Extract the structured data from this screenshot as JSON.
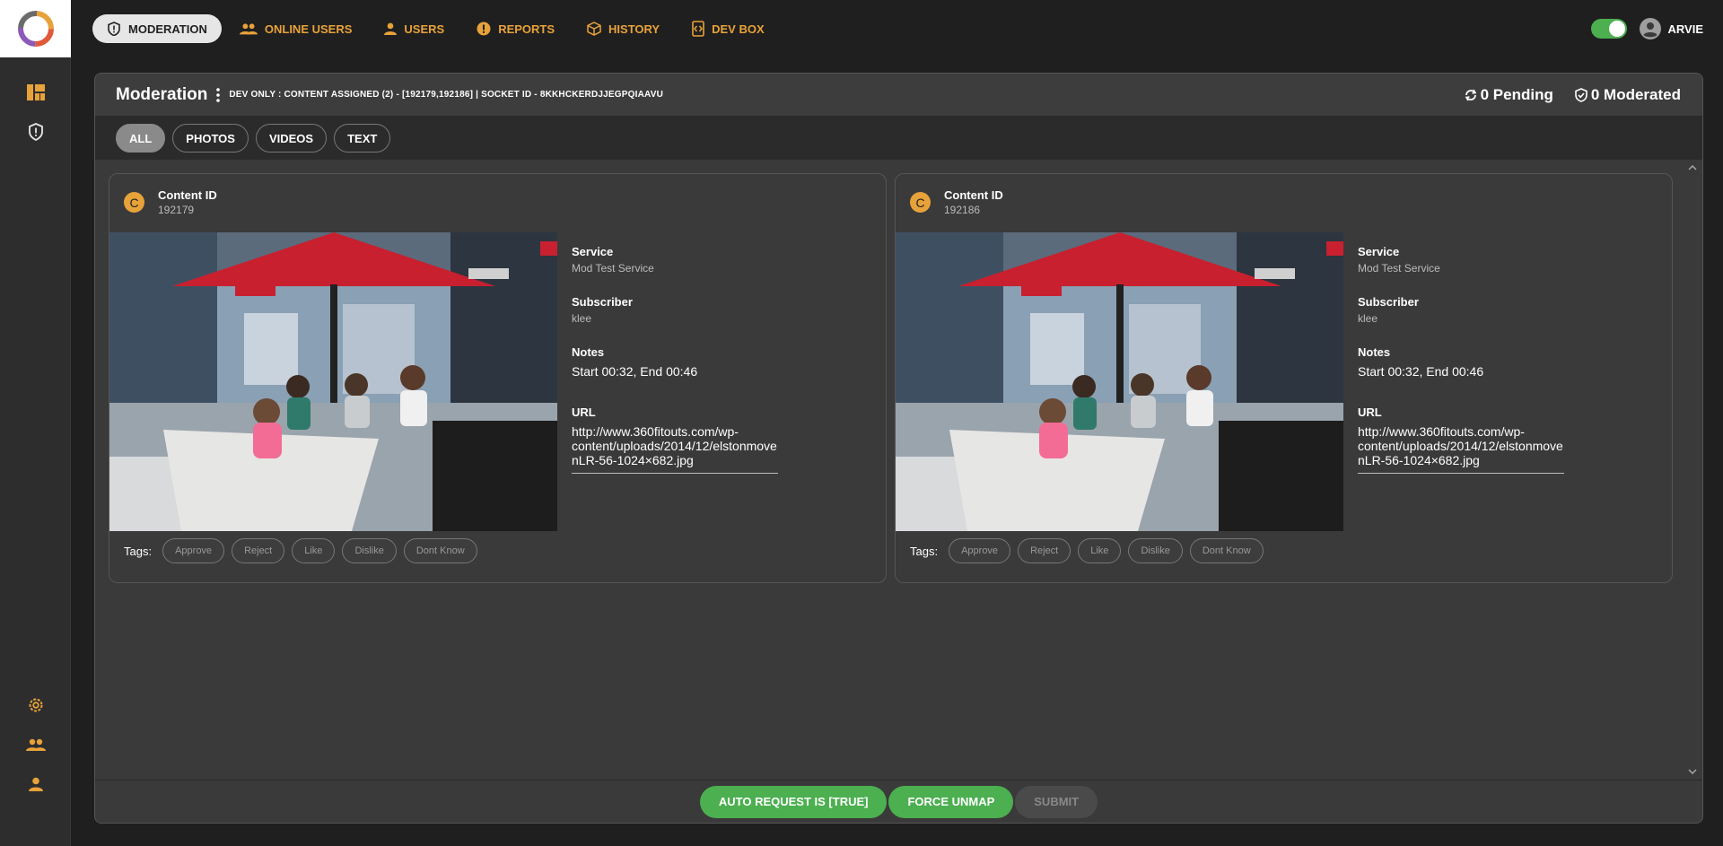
{
  "nav": {
    "items": [
      {
        "label": "MODERATION",
        "icon": "shield-alert-icon"
      },
      {
        "label": "ONLINE USERS",
        "icon": "group-icon"
      },
      {
        "label": "USERS",
        "icon": "person-icon"
      },
      {
        "label": "REPORTS",
        "icon": "alert-circle-icon"
      },
      {
        "label": "HISTORY",
        "icon": "cube-icon"
      },
      {
        "label": "DEV BOX",
        "icon": "code-file-icon"
      }
    ],
    "user_name": "ARVIE"
  },
  "panel": {
    "title": "Moderation",
    "dev_info": "DEV ONLY : CONTENT ASSIGNED (2) - [192179,192186] | SOCKET ID - 8KKHCKERDJJEGPQIAAVU",
    "pending": "0 Pending",
    "moderated": "0 Moderated"
  },
  "filters": [
    "ALL",
    "PHOTOS",
    "VIDEOS",
    "TEXT"
  ],
  "cards": [
    {
      "avatar_letter": "C",
      "content_id_label": "Content ID",
      "content_id": "192179",
      "service_label": "Service",
      "service": "Mod Test Service",
      "subscriber_label": "Subscriber",
      "subscriber": "klee",
      "notes_label": "Notes",
      "notes": "Start 00:32, End 00:46",
      "url_label": "URL",
      "url": "http://www.360fitouts.com/wp-content/uploads/2014/12/elstonmovenLR-56-1024×682.jpg",
      "tags_label": "Tags:",
      "tags": [
        "Approve",
        "Reject",
        "Like",
        "Dislike",
        "Dont Know"
      ]
    },
    {
      "avatar_letter": "C",
      "content_id_label": "Content ID",
      "content_id": "192186",
      "service_label": "Service",
      "service": "Mod Test Service",
      "subscriber_label": "Subscriber",
      "subscriber": "klee",
      "notes_label": "Notes",
      "notes": "Start 00:32, End 00:46",
      "url_label": "URL",
      "url": "http://www.360fitouts.com/wp-content/uploads/2014/12/elstonmovenLR-56-1024×682.jpg",
      "tags_label": "Tags:",
      "tags": [
        "Approve",
        "Reject",
        "Like",
        "Dislike",
        "Dont Know"
      ]
    }
  ],
  "footer": {
    "auto_request": "AUTO REQUEST IS [TRUE]",
    "force_unmap": "FORCE UNMAP",
    "submit": "SUBMIT"
  },
  "colors": {
    "accent": "#e8a23a",
    "green": "#4caf50",
    "background": "#1f1f1f",
    "panel": "#3a3a3a"
  }
}
